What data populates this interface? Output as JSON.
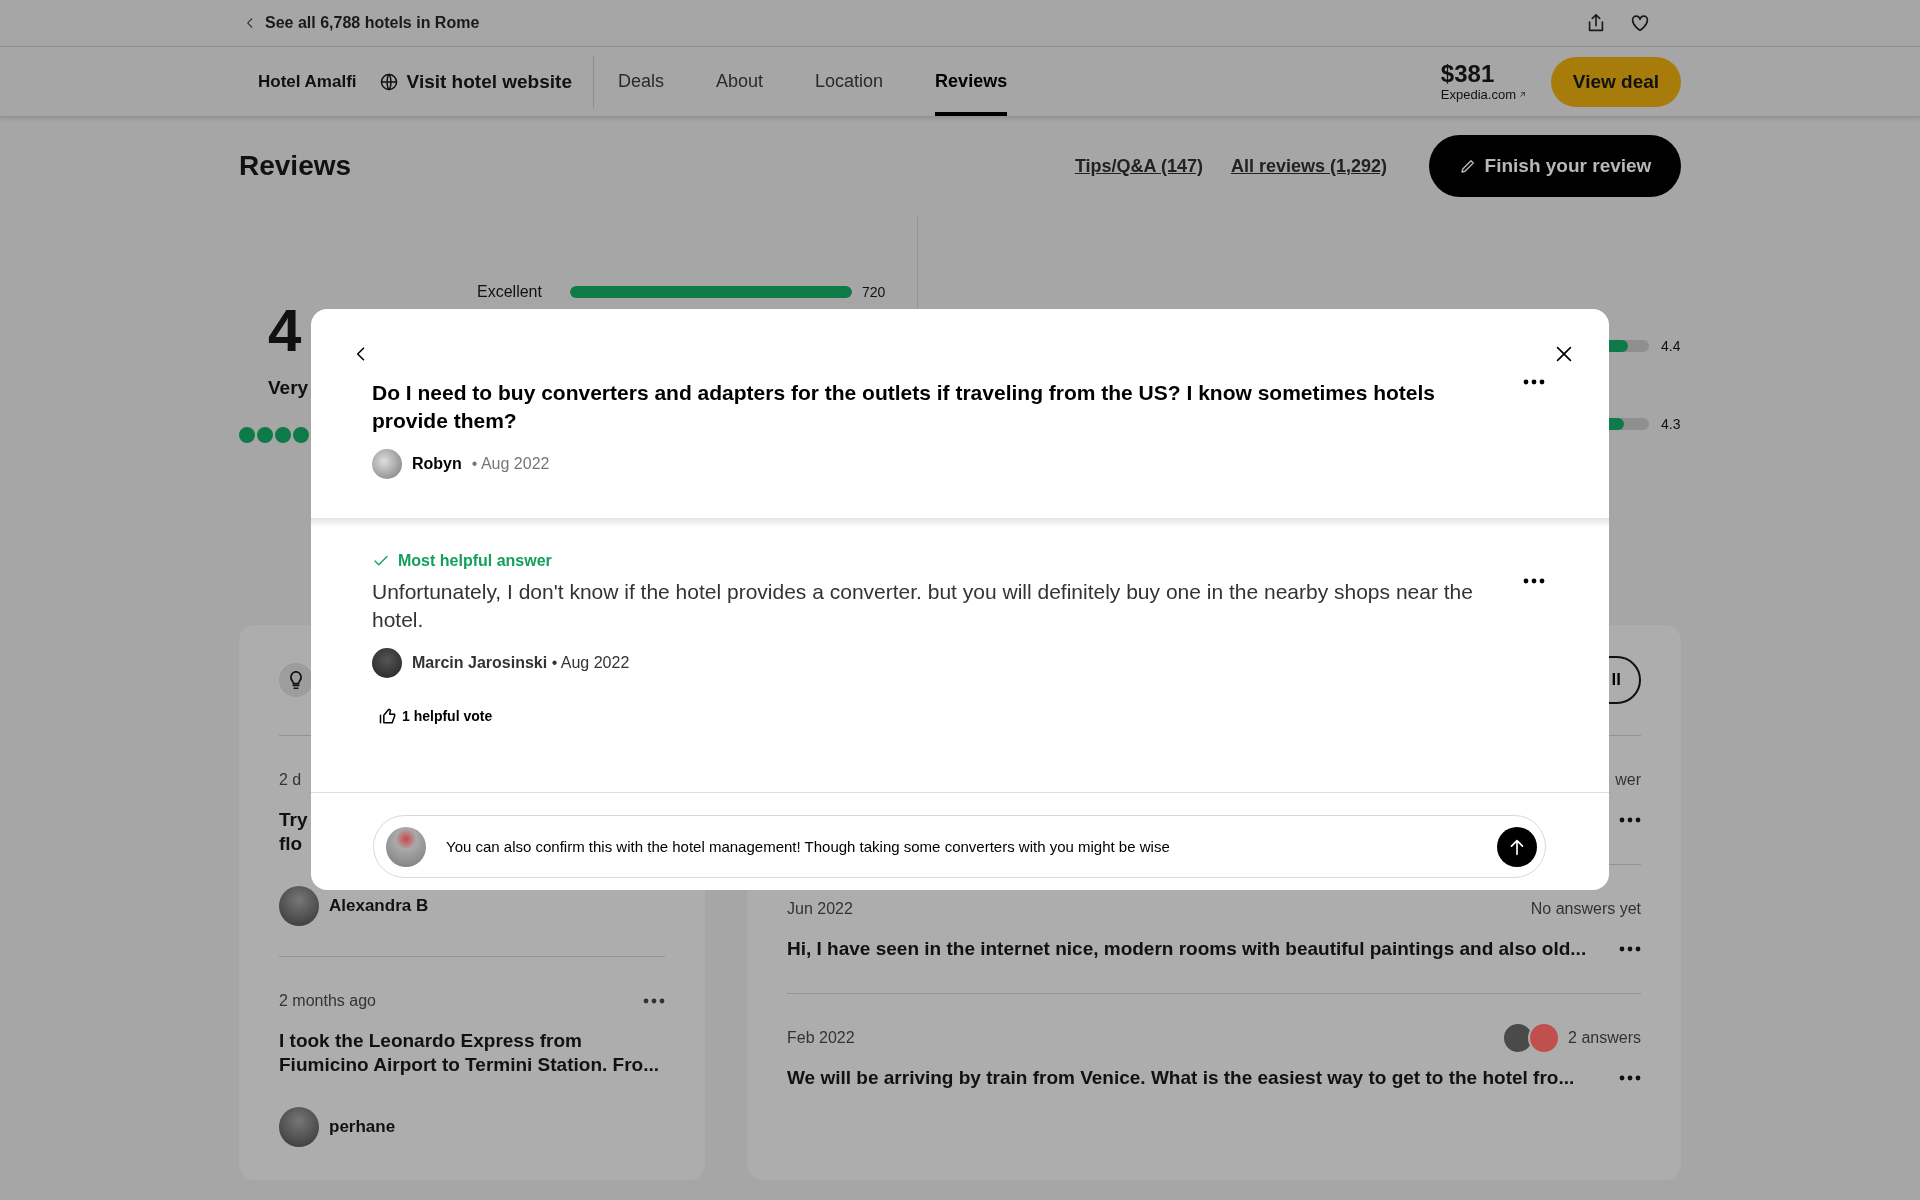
{
  "top_bar": {
    "back_link": "See all 6,788 hotels in Rome"
  },
  "nav": {
    "hotel_name": "Hotel Amalfi",
    "website_link": "Visit hotel website",
    "tabs": [
      {
        "label": "Deals",
        "selected": false
      },
      {
        "label": "About",
        "selected": false
      },
      {
        "label": "Location",
        "selected": false
      },
      {
        "label": "Reviews",
        "selected": true
      }
    ],
    "price": "$381",
    "provider": "Expedia.com",
    "deal_button": "View deal"
  },
  "reviews_header": {
    "title": "Reviews",
    "links": [
      "Tips/Q&A (147)",
      "All reviews (1,292)"
    ],
    "button": "Finish your review"
  },
  "rating_summary": {
    "score": "4",
    "label": "Very",
    "stars": 4,
    "distribution": [
      {
        "label": "Excellent",
        "level": 1,
        "count": "720"
      }
    ],
    "subratings": [
      {
        "level": 0.9,
        "value": "4.4"
      },
      {
        "level": 0.88,
        "value": "4.3"
      }
    ]
  },
  "tips_card": {
    "items": [
      {
        "date": "2 d",
        "title_lines": [
          "Try",
          "flo"
        ],
        "author": "Alexandra B"
      },
      {
        "date": "2 months ago",
        "title_lines": [
          "I took the Leonardo Express from",
          "Fiumicino Airport to Termini Station. Fro..."
        ],
        "author": "perhane"
      }
    ]
  },
  "qa_card": {
    "button": "ll",
    "items": [
      {
        "status": "wer"
      },
      {
        "date": "Jun 2022",
        "status": "No answers yet",
        "question": "Hi, I have seen in the internet nice, modern rooms with beautiful paintings and also old..."
      },
      {
        "date": "Feb 2022",
        "status": "2 answers",
        "question": "We will be arriving by train from Venice. What is the easiest way to get to the hotel fro...",
        "avatars": [
          {
            "color": "#4a4a4a"
          },
          {
            "color": "#c0504d"
          }
        ]
      }
    ]
  },
  "modal": {
    "question": "Do I need to buy converters and adapters for the outlets if traveling from the US? I know sometimes hotels provide them?",
    "asker": "Robyn",
    "asked_date": "• Aug 2022",
    "badge": "Most helpful answer",
    "answer": "Unfortunately, I don't know if the hotel provides a converter. but you will definitely buy one in the nearby shops near the hotel.",
    "answerer": "Marcin Jarosinski",
    "answer_date": "• Aug 2022",
    "helpful_votes": "1 helpful vote",
    "reply_input": {
      "value": "You can also confirm this with the hotel management! Though taking some converters with you might be wise"
    }
  }
}
